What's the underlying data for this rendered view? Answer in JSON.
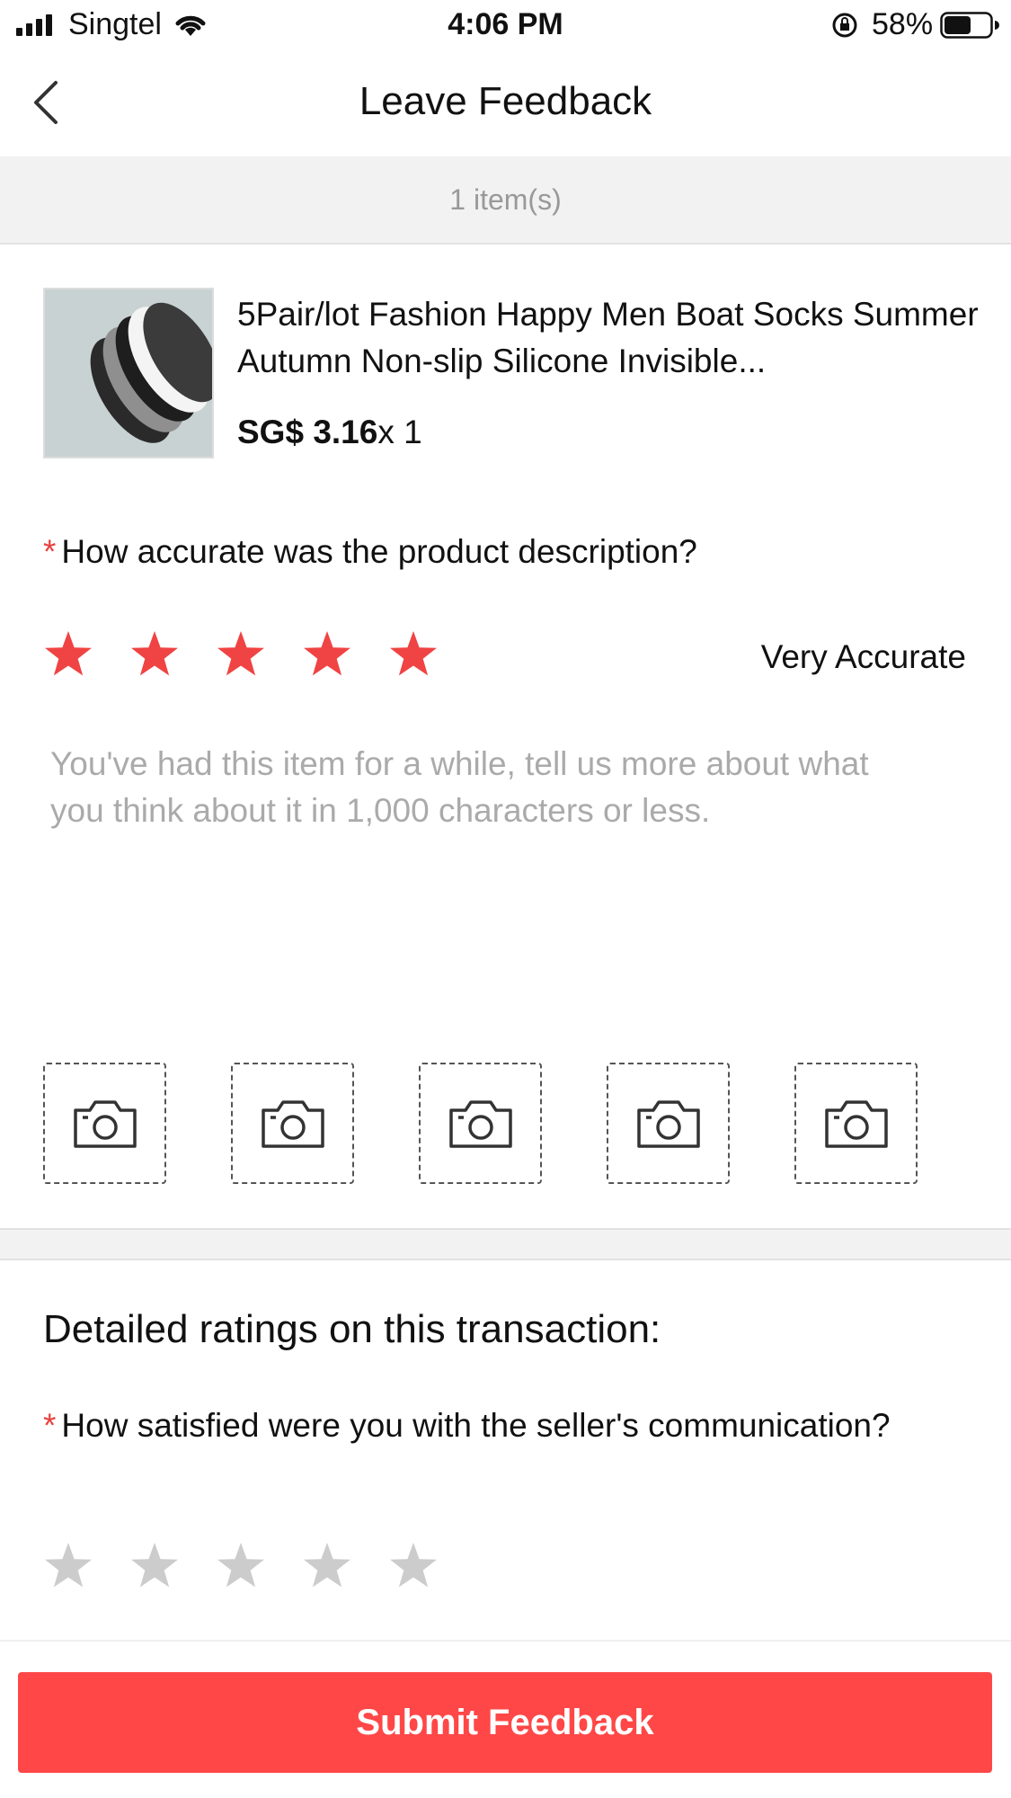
{
  "status_bar": {
    "carrier": "Singtel",
    "time": "4:06 PM",
    "battery_percent": "58%",
    "battery_level": 0.58,
    "icons": [
      "signal-icon",
      "wifi-icon",
      "orientation-lock-icon",
      "battery-icon"
    ]
  },
  "nav": {
    "title": "Leave Feedback",
    "back_icon": "chevron-left-icon"
  },
  "items_count": "1 item(s)",
  "product": {
    "name": "5Pair/lot Fashion Happy Men Boat Socks Summer Autumn Non-slip Silicone Invisible...",
    "price": "SG$ 3.16",
    "quantity": "x 1"
  },
  "description_question": {
    "required_mark": "*",
    "text": "How accurate was the product description?",
    "rating": 5,
    "max_rating": 5,
    "rating_label": "Very Accurate"
  },
  "feedback_input": {
    "placeholder": "You've had this item for a while, tell us more about what you think about it in 1,000 characters or less.",
    "value": ""
  },
  "photo_slots": {
    "count": 5,
    "icon": "camera-icon"
  },
  "detailed_ratings": {
    "heading": "Detailed ratings on this transaction:",
    "communication_question": {
      "required_mark": "*",
      "text": "How satisfied were you with the seller's communication?",
      "rating": 0,
      "max_rating": 5
    }
  },
  "submit_label": "Submit Feedback",
  "colors": {
    "accent": "#ff4747",
    "star_active": "#f04343",
    "star_inactive": "#cccccc",
    "strip_background": "#f2f2f2",
    "placeholder_text": "#aaaaaa"
  }
}
